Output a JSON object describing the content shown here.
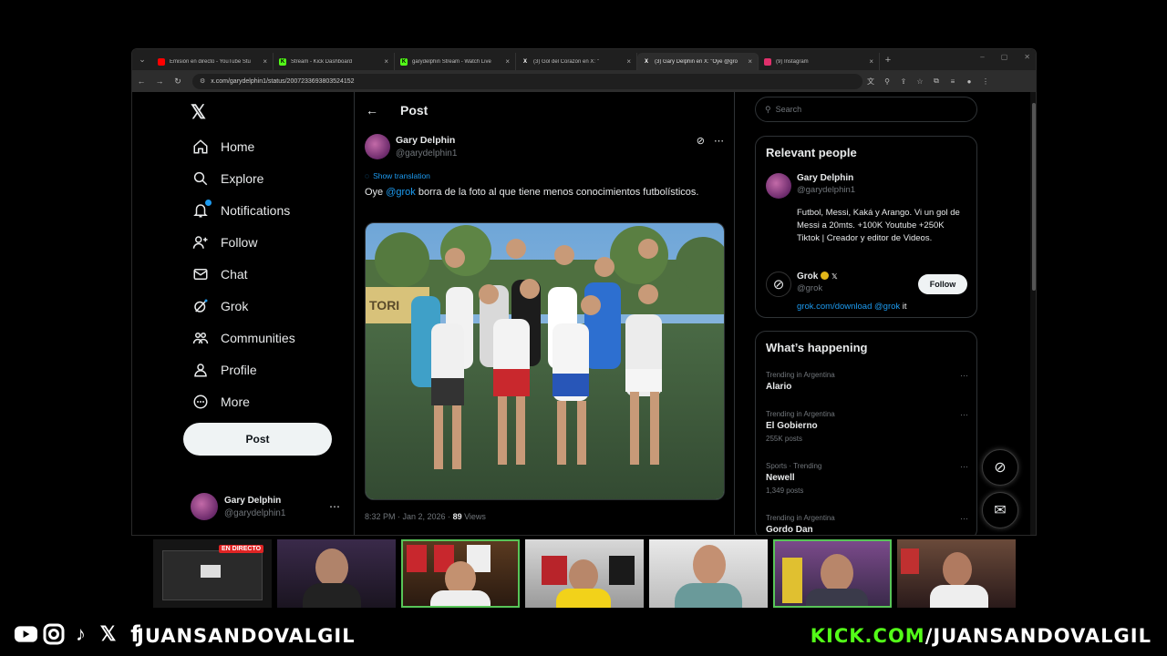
{
  "browser": {
    "tabs": [
      {
        "title": "Emisión en directo - YouTube Stu",
        "fav_color": "#ff0000"
      },
      {
        "title": "Stream - Kick Dashboard",
        "fav_color": "#53fc18"
      },
      {
        "title": "garydelphin Stream - Watch Live",
        "fav_color": "#53fc18"
      },
      {
        "title": "(3) Gol del Corazón en X: \"",
        "fav_color": "#ffffff"
      },
      {
        "title": "(3) Gary Delphin en X: \"Oye @gro",
        "fav_color": "#ffffff"
      },
      {
        "title": "(9) Instagram",
        "fav_color": "#e1306c"
      }
    ],
    "url": "x.com/garydelphin1/status/2007233693803524152"
  },
  "nav": {
    "logo": "𝕏",
    "items": [
      {
        "label": "Home",
        "icon": "⌂"
      },
      {
        "label": "Explore",
        "icon": "⚲"
      },
      {
        "label": "Notifications",
        "icon": "🔔"
      },
      {
        "label": "Follow",
        "icon": "👤"
      },
      {
        "label": "Chat",
        "icon": "✉"
      },
      {
        "label": "Grok",
        "icon": "⊘"
      },
      {
        "label": "Communities",
        "icon": "👥"
      },
      {
        "label": "Profile",
        "icon": "👤"
      },
      {
        "label": "More",
        "icon": "⋯"
      }
    ],
    "post_button": "Post",
    "account": {
      "name": "Gary Delphin",
      "handle": "@garydelphin1"
    }
  },
  "main": {
    "header_title": "Post",
    "author": {
      "name": "Gary Delphin",
      "handle": "@garydelphin1"
    },
    "translate": "Show translation",
    "text_before": "Oye ",
    "mention": "@grok",
    "text_after": " borra de la foto al que tiene menos conocimientos futbolísticos.",
    "meta_time": "8:32 PM · Jan 2, 2026 · ",
    "views_count": "89",
    "views_label": " Views",
    "photo_banner": "TORI"
  },
  "sidebar": {
    "search_placeholder": "Search",
    "relevant_title": "Relevant people",
    "person1": {
      "name": "Gary Delphin",
      "handle": "@garydelphin1",
      "bio": "Futbol, Messi, Kaká y Arango. Vi un gol de Messi a 20mts. +100K Youtube +250K Tiktok | Creador y editor de Videos."
    },
    "person2": {
      "name": "Grok",
      "extra": "𝕏",
      "handle": "@grok",
      "bio_link": "grok.com/download @grok",
      "bio_rest": " it",
      "follow": "Follow"
    },
    "happening_title": "What’s happening",
    "trends": [
      {
        "context": "Trending in Argentina",
        "name": "Alario",
        "count": ""
      },
      {
        "context": "Trending in Argentina",
        "name": "El Gobierno",
        "count": "255K posts"
      },
      {
        "context": "Sports · Trending",
        "name": "Newell",
        "count": "1,349 posts"
      },
      {
        "context": "Trending in Argentina",
        "name": "Gordo Dan",
        "count": ""
      }
    ]
  },
  "stream": {
    "live_badge": "EN DIRECTO",
    "footer_left": "JUANSANDOVALGIL",
    "footer_kick": "KICK.COM",
    "footer_rest": "/JUANSANDOVALGIL",
    "social_icons": [
      "youtube-icon",
      "instagram-icon",
      "tiktok-icon",
      "x-icon",
      "facebook-icon"
    ]
  }
}
